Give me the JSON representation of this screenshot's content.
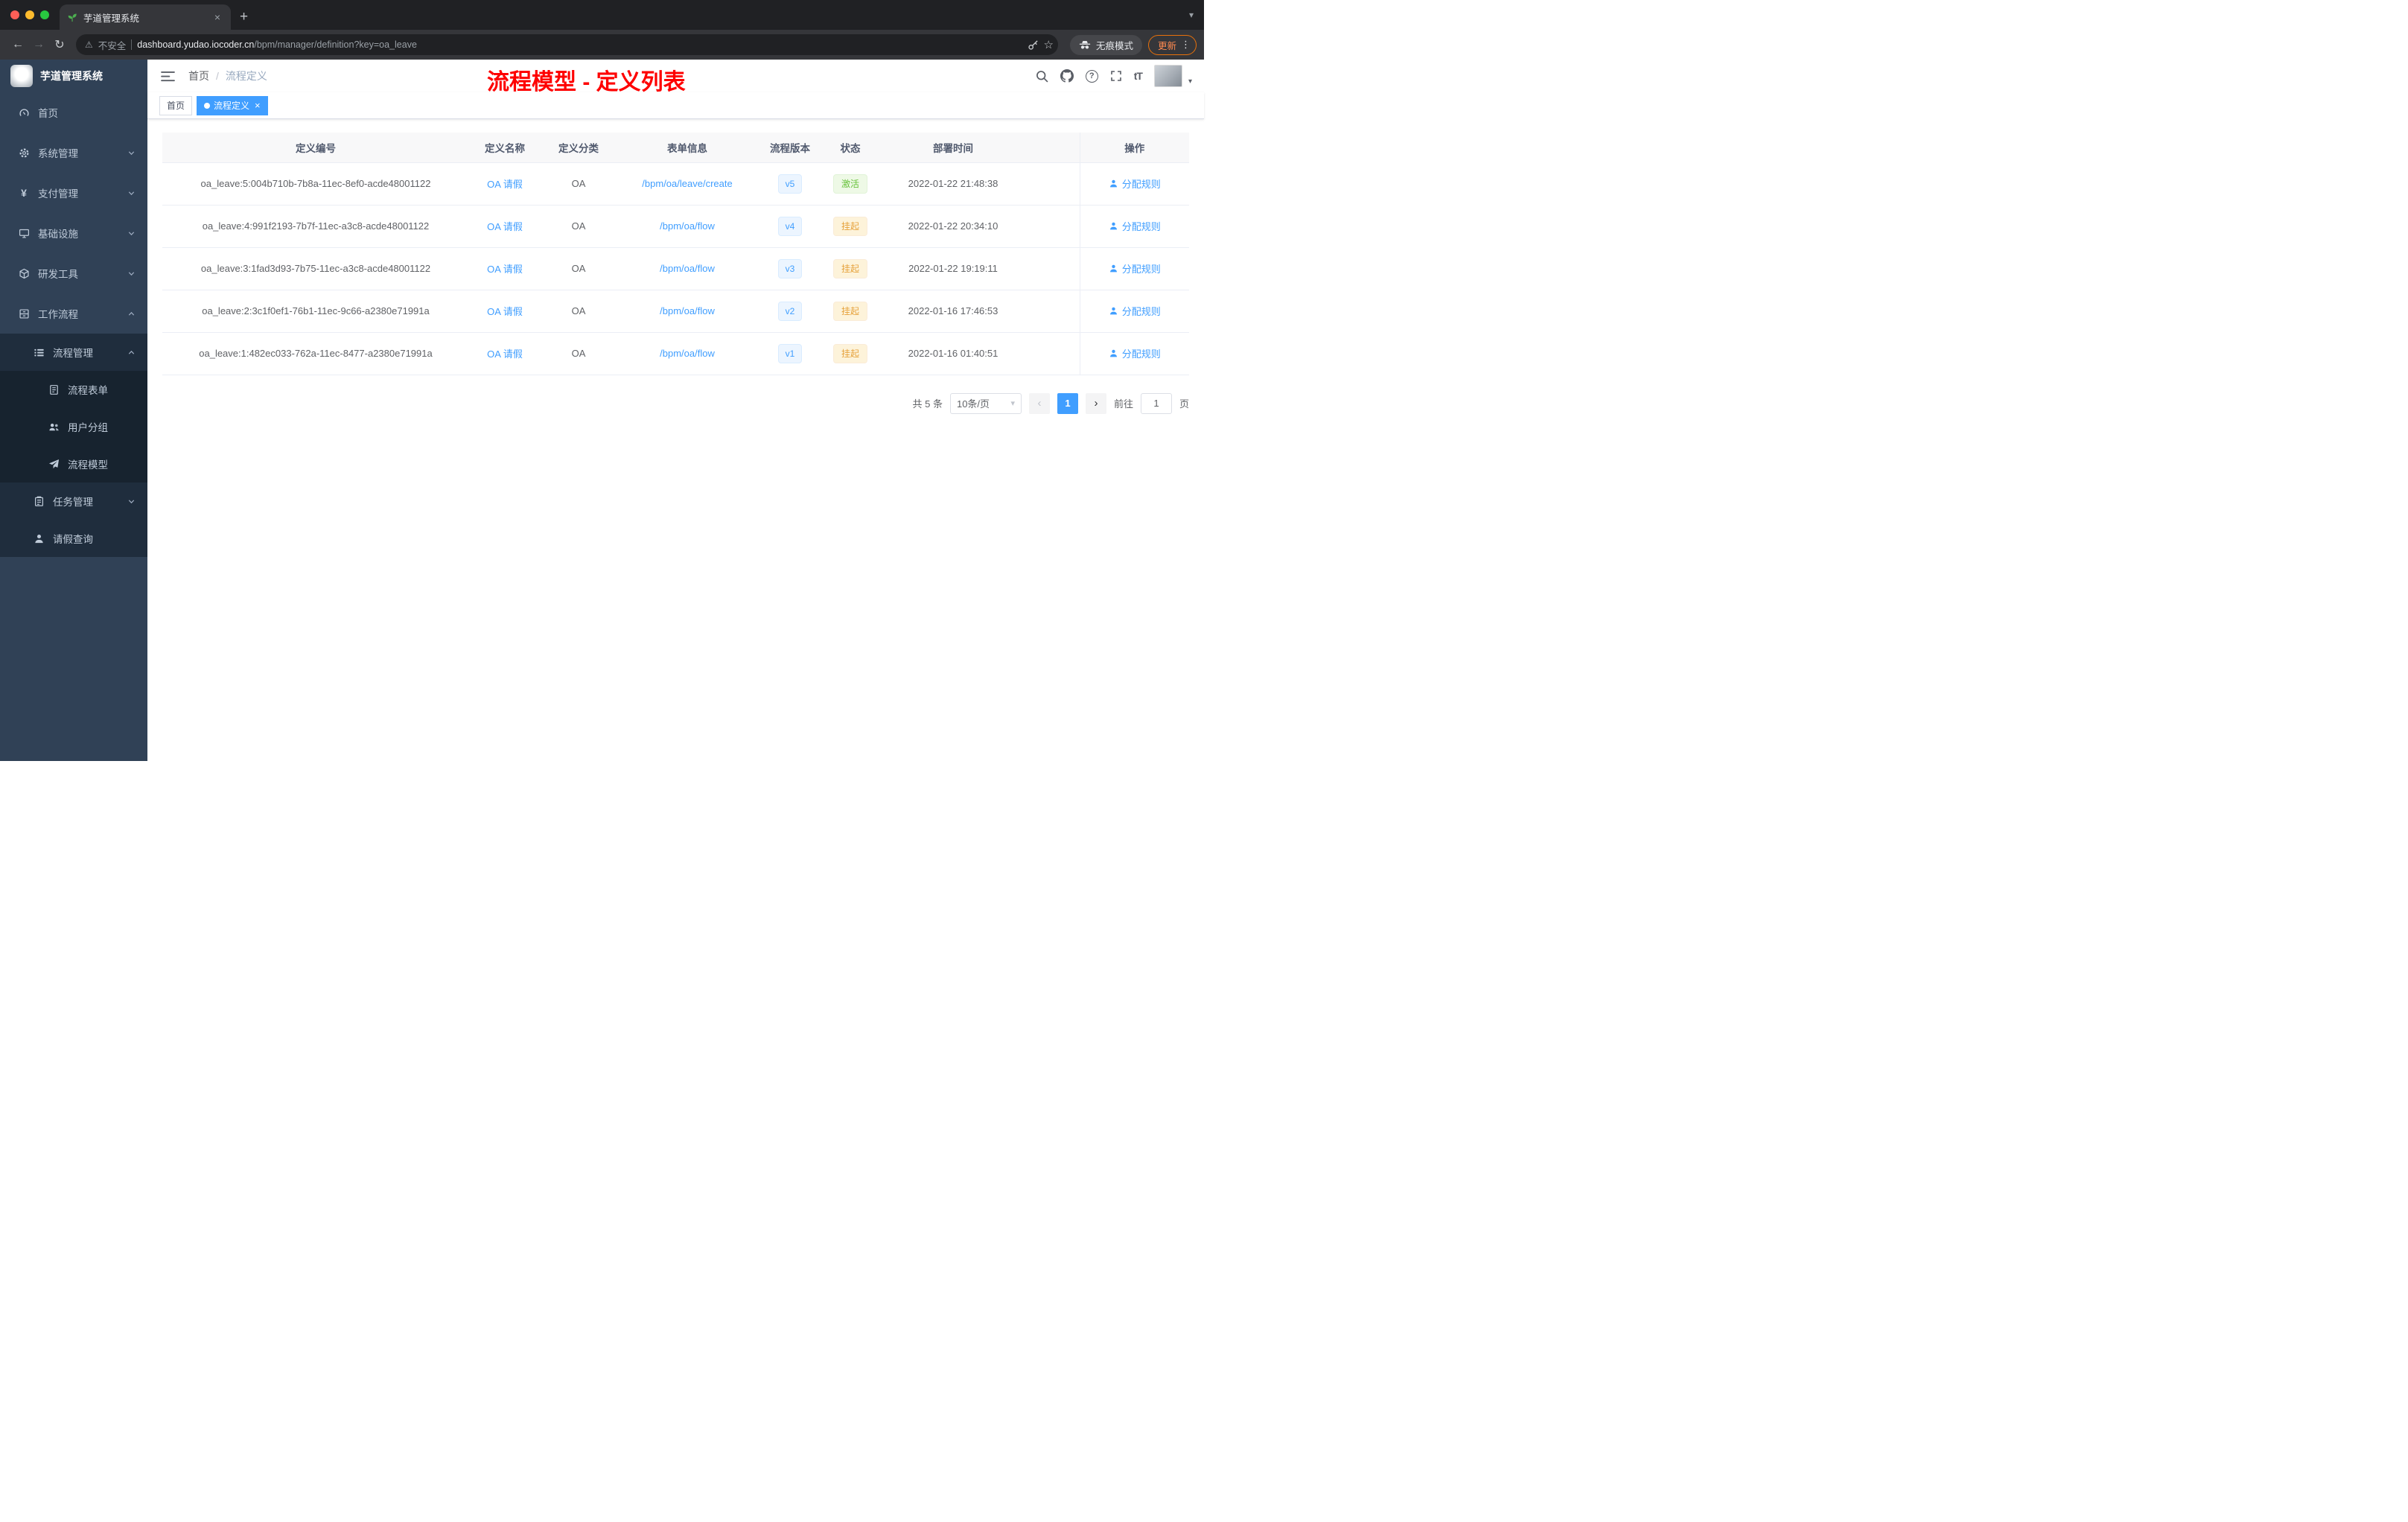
{
  "browser": {
    "tab_title": "芋道管理系统",
    "address": {
      "security_label": "不安全",
      "host": "dashboard.yudao.iocoder.cn",
      "path": "/bpm/manager/definition?key=oa_leave",
      "incognito_label": "无痕模式",
      "update_label": "更新"
    }
  },
  "icons": {
    "close": "×",
    "new_tab": "+",
    "back": "←",
    "forward": "→",
    "reload": "↻",
    "warning": "⚠",
    "star": "☆",
    "more": "⋮",
    "caret_down": "▾",
    "prev": "‹",
    "next": "›",
    "font_size": "tT",
    "question": "?",
    "yen": "¥"
  },
  "sidebar": {
    "logo_title": "芋道管理系统",
    "items": [
      {
        "label": "首页"
      },
      {
        "label": "系统管理"
      },
      {
        "label": "支付管理"
      },
      {
        "label": "基础设施"
      },
      {
        "label": "研发工具"
      },
      {
        "label": "工作流程"
      },
      {
        "label": "流程管理"
      },
      {
        "label": "流程表单"
      },
      {
        "label": "用户分组"
      },
      {
        "label": "流程模型"
      },
      {
        "label": "任务管理"
      },
      {
        "label": "请假查询"
      }
    ]
  },
  "header": {
    "breadcrumb_home": "首页",
    "breadcrumb_separator": "/",
    "breadcrumb_current": "流程定义",
    "annotation": "流程模型 - 定义列表"
  },
  "tags": {
    "home": "首页",
    "active": "流程定义"
  },
  "table": {
    "columns": {
      "id": "定义编号",
      "name": "定义名称",
      "category": "定义分类",
      "form": "表单信息",
      "version": "流程版本",
      "status": "状态",
      "deploy_time": "部署时间",
      "action": "操作"
    },
    "rows": [
      {
        "id": "oa_leave:5:004b710b-7b8a-11ec-8ef0-acde48001122",
        "name": "OA 请假",
        "category": "OA",
        "form": "/bpm/oa/leave/create",
        "version": "v5",
        "status": "激活",
        "deploy_time": "2022-01-22 21:48:38",
        "action": "分配规则"
      },
      {
        "id": "oa_leave:4:991f2193-7b7f-11ec-a3c8-acde48001122",
        "name": "OA 请假",
        "category": "OA",
        "form": "/bpm/oa/flow",
        "version": "v4",
        "status": "挂起",
        "deploy_time": "2022-01-22 20:34:10",
        "action": "分配规则"
      },
      {
        "id": "oa_leave:3:1fad3d93-7b75-11ec-a3c8-acde48001122",
        "name": "OA 请假",
        "category": "OA",
        "form": "/bpm/oa/flow",
        "version": "v3",
        "status": "挂起",
        "deploy_time": "2022-01-22 19:19:11",
        "action": "分配规则"
      },
      {
        "id": "oa_leave:2:3c1f0ef1-76b1-11ec-9c66-a2380e71991a",
        "name": "OA 请假",
        "category": "OA",
        "form": "/bpm/oa/flow",
        "version": "v2",
        "status": "挂起",
        "deploy_time": "2022-01-16 17:46:53",
        "action": "分配规则"
      },
      {
        "id": "oa_leave:1:482ec033-762a-11ec-8477-a2380e71991a",
        "name": "OA 请假",
        "category": "OA",
        "form": "/bpm/oa/flow",
        "version": "v1",
        "status": "挂起",
        "deploy_time": "2022-01-16 01:40:51",
        "action": "分配规则"
      }
    ]
  },
  "pagination": {
    "total": "共 5 条",
    "page_size": "10条/页",
    "current_page": "1",
    "goto_label": "前往",
    "goto_value": "1",
    "unit_label": "页"
  },
  "colors": {
    "accent_blue": "#409eff",
    "success_green": "#67c23a",
    "warning_orange": "#e6a23c",
    "annotation_red": "#fe0000",
    "sidebar_bg": "#304156",
    "sidebar_sub_bg": "#1f2d3d"
  }
}
